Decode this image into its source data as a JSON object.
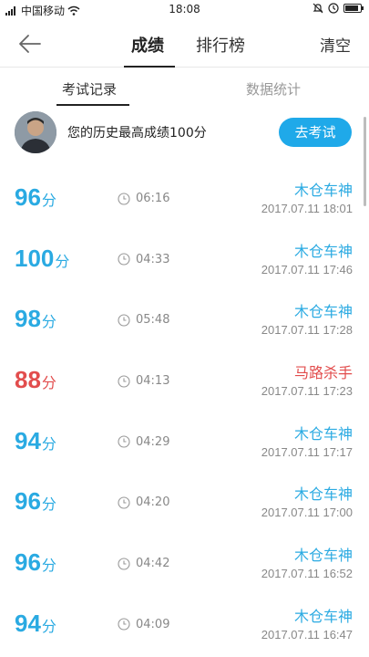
{
  "status_bar": {
    "carrier": "中国移动",
    "time": "18:08",
    "battery_level": 0.9
  },
  "header": {
    "tabs": [
      {
        "label": "成绩"
      },
      {
        "label": "排行榜"
      }
    ],
    "clear_label": "清空"
  },
  "subtabs": [
    {
      "label": "考试记录"
    },
    {
      "label": "数据统计"
    }
  ],
  "banner": {
    "best_text": "您的历史最高成绩100分",
    "exam_button": "去考试"
  },
  "colors": {
    "accent": "#2aaae2",
    "button": "#1fa9e9",
    "fail": "#e24d4d"
  },
  "records": [
    {
      "score": "96",
      "unit": "分",
      "duration": "06:16",
      "title": "木仓车神",
      "datetime": "2017.07.11  18:01",
      "fail": false
    },
    {
      "score": "100",
      "unit": "分",
      "duration": "04:33",
      "title": "木仓车神",
      "datetime": "2017.07.11  17:46",
      "fail": false
    },
    {
      "score": "98",
      "unit": "分",
      "duration": "05:48",
      "title": "木仓车神",
      "datetime": "2017.07.11  17:28",
      "fail": false
    },
    {
      "score": "88",
      "unit": "分",
      "duration": "04:13",
      "title": "马路杀手",
      "datetime": "2017.07.11  17:23",
      "fail": true
    },
    {
      "score": "94",
      "unit": "分",
      "duration": "04:29",
      "title": "木仓车神",
      "datetime": "2017.07.11  17:17",
      "fail": false
    },
    {
      "score": "96",
      "unit": "分",
      "duration": "04:20",
      "title": "木仓车神",
      "datetime": "2017.07.11  17:00",
      "fail": false
    },
    {
      "score": "96",
      "unit": "分",
      "duration": "04:42",
      "title": "木仓车神",
      "datetime": "2017.07.11  16:52",
      "fail": false
    },
    {
      "score": "94",
      "unit": "分",
      "duration": "04:09",
      "title": "木仓车神",
      "datetime": "2017.07.11  16:47",
      "fail": false
    }
  ]
}
